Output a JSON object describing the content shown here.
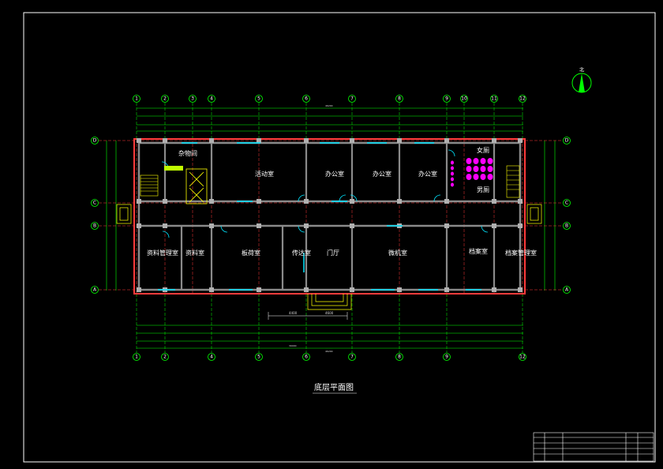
{
  "drawing": {
    "title": "底层平面图",
    "north_label": "北",
    "colors": {
      "background": "#000000",
      "frame": "#ffffff",
      "wall": "#ff3b3b",
      "wall_fill": "#8a8a8a",
      "dimension": "#00ff00",
      "door": "#00e5ff",
      "stair": "#ffff00",
      "toilet": "#ff00ff",
      "hatch": "#c0ff00",
      "column": "#b0b0b0"
    },
    "axes_horizontal_top": [
      "1",
      "2",
      "3",
      "4",
      "5",
      "6",
      "7",
      "8",
      "9",
      "10",
      "11",
      "12"
    ],
    "axes_horizontal_bottom": [
      "1",
      "2",
      "4",
      "5",
      "6",
      "7",
      "8",
      "9",
      "12"
    ],
    "axes_vertical": [
      "D",
      "C",
      "B",
      "A"
    ],
    "rooms": [
      {
        "id": "storage",
        "label": "杂物间"
      },
      {
        "id": "activity",
        "label": "活动室"
      },
      {
        "id": "office1",
        "label": "办公室"
      },
      {
        "id": "office2",
        "label": "办公室"
      },
      {
        "id": "office3",
        "label": "办公室"
      },
      {
        "id": "female-wc",
        "label": "女厕"
      },
      {
        "id": "male-wc",
        "label": "男厕"
      },
      {
        "id": "data-mgmt",
        "label": "资料管理室"
      },
      {
        "id": "data-room",
        "label": "资料室"
      },
      {
        "id": "report",
        "label": "板荷室"
      },
      {
        "id": "reception",
        "label": "传达室"
      },
      {
        "id": "lobby",
        "label": "门厅"
      },
      {
        "id": "computer",
        "label": "微机室"
      },
      {
        "id": "archive",
        "label": "档案室"
      },
      {
        "id": "archive-mgmt",
        "label": "档案管理室"
      }
    ],
    "dimensions": {
      "overall": "46200",
      "bottom_total": "39000",
      "entrance_left": "4400",
      "entrance_right": "4600"
    }
  }
}
